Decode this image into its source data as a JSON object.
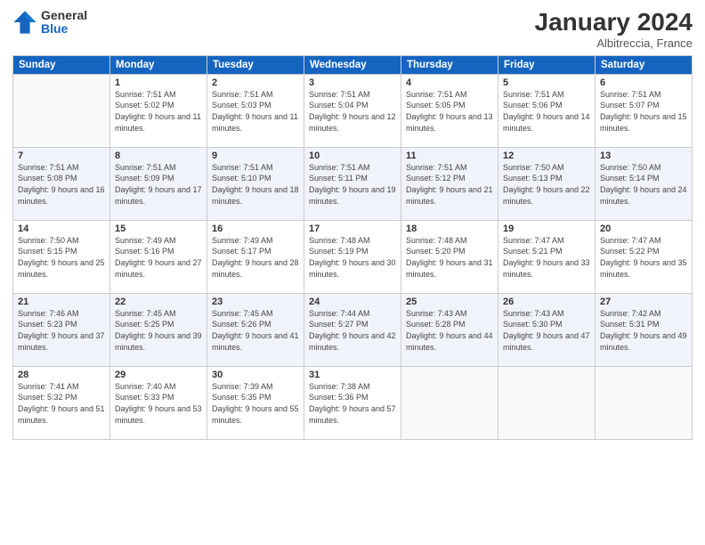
{
  "header": {
    "logo_general": "General",
    "logo_blue": "Blue",
    "month_title": "January 2024",
    "location": "Albitreccia, France"
  },
  "weekdays": [
    "Sunday",
    "Monday",
    "Tuesday",
    "Wednesday",
    "Thursday",
    "Friday",
    "Saturday"
  ],
  "weeks": [
    [
      {
        "day": "",
        "sunrise": "",
        "sunset": "",
        "daylight": ""
      },
      {
        "day": "1",
        "sunrise": "Sunrise: 7:51 AM",
        "sunset": "Sunset: 5:02 PM",
        "daylight": "Daylight: 9 hours and 11 minutes."
      },
      {
        "day": "2",
        "sunrise": "Sunrise: 7:51 AM",
        "sunset": "Sunset: 5:03 PM",
        "daylight": "Daylight: 9 hours and 11 minutes."
      },
      {
        "day": "3",
        "sunrise": "Sunrise: 7:51 AM",
        "sunset": "Sunset: 5:04 PM",
        "daylight": "Daylight: 9 hours and 12 minutes."
      },
      {
        "day": "4",
        "sunrise": "Sunrise: 7:51 AM",
        "sunset": "Sunset: 5:05 PM",
        "daylight": "Daylight: 9 hours and 13 minutes."
      },
      {
        "day": "5",
        "sunrise": "Sunrise: 7:51 AM",
        "sunset": "Sunset: 5:06 PM",
        "daylight": "Daylight: 9 hours and 14 minutes."
      },
      {
        "day": "6",
        "sunrise": "Sunrise: 7:51 AM",
        "sunset": "Sunset: 5:07 PM",
        "daylight": "Daylight: 9 hours and 15 minutes."
      }
    ],
    [
      {
        "day": "7",
        "sunrise": "Sunrise: 7:51 AM",
        "sunset": "Sunset: 5:08 PM",
        "daylight": "Daylight: 9 hours and 16 minutes."
      },
      {
        "day": "8",
        "sunrise": "Sunrise: 7:51 AM",
        "sunset": "Sunset: 5:09 PM",
        "daylight": "Daylight: 9 hours and 17 minutes."
      },
      {
        "day": "9",
        "sunrise": "Sunrise: 7:51 AM",
        "sunset": "Sunset: 5:10 PM",
        "daylight": "Daylight: 9 hours and 18 minutes."
      },
      {
        "day": "10",
        "sunrise": "Sunrise: 7:51 AM",
        "sunset": "Sunset: 5:11 PM",
        "daylight": "Daylight: 9 hours and 19 minutes."
      },
      {
        "day": "11",
        "sunrise": "Sunrise: 7:51 AM",
        "sunset": "Sunset: 5:12 PM",
        "daylight": "Daylight: 9 hours and 21 minutes."
      },
      {
        "day": "12",
        "sunrise": "Sunrise: 7:50 AM",
        "sunset": "Sunset: 5:13 PM",
        "daylight": "Daylight: 9 hours and 22 minutes."
      },
      {
        "day": "13",
        "sunrise": "Sunrise: 7:50 AM",
        "sunset": "Sunset: 5:14 PM",
        "daylight": "Daylight: 9 hours and 24 minutes."
      }
    ],
    [
      {
        "day": "14",
        "sunrise": "Sunrise: 7:50 AM",
        "sunset": "Sunset: 5:15 PM",
        "daylight": "Daylight: 9 hours and 25 minutes."
      },
      {
        "day": "15",
        "sunrise": "Sunrise: 7:49 AM",
        "sunset": "Sunset: 5:16 PM",
        "daylight": "Daylight: 9 hours and 27 minutes."
      },
      {
        "day": "16",
        "sunrise": "Sunrise: 7:49 AM",
        "sunset": "Sunset: 5:17 PM",
        "daylight": "Daylight: 9 hours and 28 minutes."
      },
      {
        "day": "17",
        "sunrise": "Sunrise: 7:48 AM",
        "sunset": "Sunset: 5:19 PM",
        "daylight": "Daylight: 9 hours and 30 minutes."
      },
      {
        "day": "18",
        "sunrise": "Sunrise: 7:48 AM",
        "sunset": "Sunset: 5:20 PM",
        "daylight": "Daylight: 9 hours and 31 minutes."
      },
      {
        "day": "19",
        "sunrise": "Sunrise: 7:47 AM",
        "sunset": "Sunset: 5:21 PM",
        "daylight": "Daylight: 9 hours and 33 minutes."
      },
      {
        "day": "20",
        "sunrise": "Sunrise: 7:47 AM",
        "sunset": "Sunset: 5:22 PM",
        "daylight": "Daylight: 9 hours and 35 minutes."
      }
    ],
    [
      {
        "day": "21",
        "sunrise": "Sunrise: 7:46 AM",
        "sunset": "Sunset: 5:23 PM",
        "daylight": "Daylight: 9 hours and 37 minutes."
      },
      {
        "day": "22",
        "sunrise": "Sunrise: 7:45 AM",
        "sunset": "Sunset: 5:25 PM",
        "daylight": "Daylight: 9 hours and 39 minutes."
      },
      {
        "day": "23",
        "sunrise": "Sunrise: 7:45 AM",
        "sunset": "Sunset: 5:26 PM",
        "daylight": "Daylight: 9 hours and 41 minutes."
      },
      {
        "day": "24",
        "sunrise": "Sunrise: 7:44 AM",
        "sunset": "Sunset: 5:27 PM",
        "daylight": "Daylight: 9 hours and 42 minutes."
      },
      {
        "day": "25",
        "sunrise": "Sunrise: 7:43 AM",
        "sunset": "Sunset: 5:28 PM",
        "daylight": "Daylight: 9 hours and 44 minutes."
      },
      {
        "day": "26",
        "sunrise": "Sunrise: 7:43 AM",
        "sunset": "Sunset: 5:30 PM",
        "daylight": "Daylight: 9 hours and 47 minutes."
      },
      {
        "day": "27",
        "sunrise": "Sunrise: 7:42 AM",
        "sunset": "Sunset: 5:31 PM",
        "daylight": "Daylight: 9 hours and 49 minutes."
      }
    ],
    [
      {
        "day": "28",
        "sunrise": "Sunrise: 7:41 AM",
        "sunset": "Sunset: 5:32 PM",
        "daylight": "Daylight: 9 hours and 51 minutes."
      },
      {
        "day": "29",
        "sunrise": "Sunrise: 7:40 AM",
        "sunset": "Sunset: 5:33 PM",
        "daylight": "Daylight: 9 hours and 53 minutes."
      },
      {
        "day": "30",
        "sunrise": "Sunrise: 7:39 AM",
        "sunset": "Sunset: 5:35 PM",
        "daylight": "Daylight: 9 hours and 55 minutes."
      },
      {
        "day": "31",
        "sunrise": "Sunrise: 7:38 AM",
        "sunset": "Sunset: 5:36 PM",
        "daylight": "Daylight: 9 hours and 57 minutes."
      },
      {
        "day": "",
        "sunrise": "",
        "sunset": "",
        "daylight": ""
      },
      {
        "day": "",
        "sunrise": "",
        "sunset": "",
        "daylight": ""
      },
      {
        "day": "",
        "sunrise": "",
        "sunset": "",
        "daylight": ""
      }
    ]
  ]
}
